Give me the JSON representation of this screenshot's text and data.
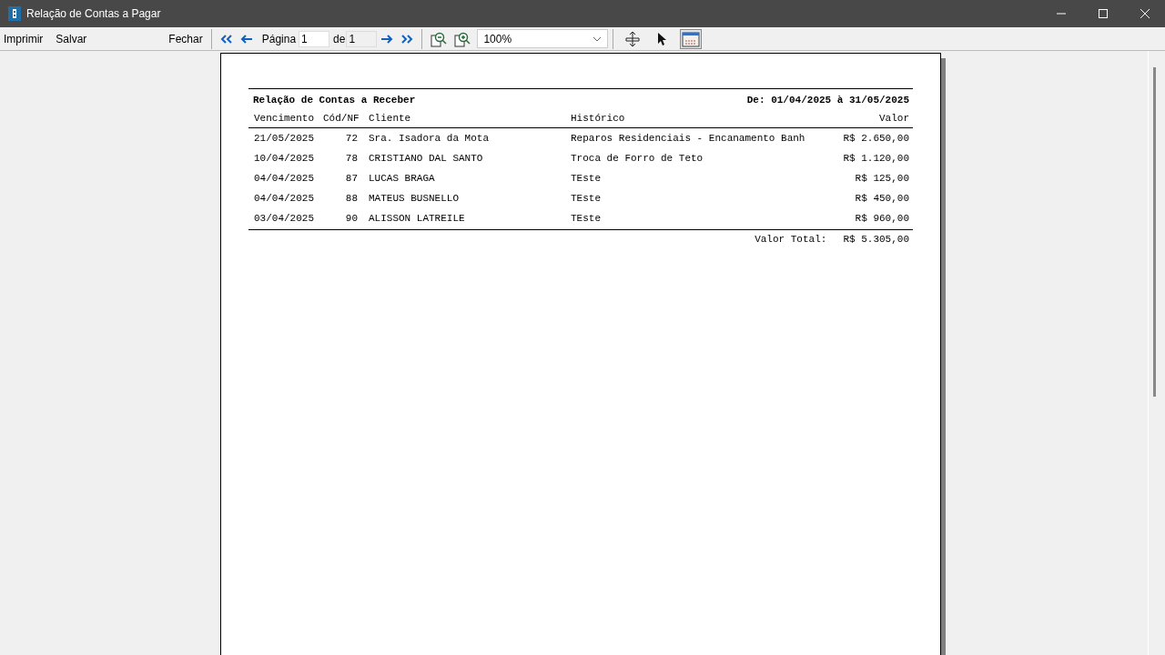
{
  "window": {
    "title": "Relação de Contas a Pagar"
  },
  "toolbar": {
    "menu": [
      "Imprimir",
      "Salvar",
      "Fechar"
    ],
    "page_label": "Página",
    "page_value": "1",
    "of_label": "de",
    "page_count": "1",
    "zoom": "100%",
    "tools": [
      {
        "kind": "fit",
        "pressed": false
      },
      {
        "kind": "pointer",
        "pressed": false
      },
      {
        "kind": "pages",
        "pressed": true
      }
    ]
  },
  "report": {
    "title": "Relação de Contas a Receber",
    "period": "De: 01/04/2025 à 31/05/2025",
    "columns": [
      "Vencimento",
      "Cód/NF",
      "Cliente",
      "Histórico",
      "Valor"
    ],
    "rows": [
      {
        "due": "21/05/2025",
        "code": "72",
        "client": "Sra. Isadora da Mota",
        "history": "Reparos Residenciais - Encanamento Banh",
        "value": "R$ 2.650,00"
      },
      {
        "due": "10/04/2025",
        "code": "78",
        "client": "CRISTIANO DAL SANTO",
        "history": "Troca de Forro de Teto",
        "value": "R$ 1.120,00"
      },
      {
        "due": "04/04/2025",
        "code": "87",
        "client": "LUCAS BRAGA",
        "history": "TEste",
        "value": "R$ 125,00"
      },
      {
        "due": "04/04/2025",
        "code": "88",
        "client": "MATEUS BUSNELLO",
        "history": "TEste",
        "value": "R$ 450,00"
      },
      {
        "due": "03/04/2025",
        "code": "90",
        "client": "ALISSON LATREILE",
        "history": "TEste",
        "value": "R$ 960,00"
      }
    ],
    "total_label": "Valor Total:",
    "total_value": "R$ 5.305,00"
  }
}
